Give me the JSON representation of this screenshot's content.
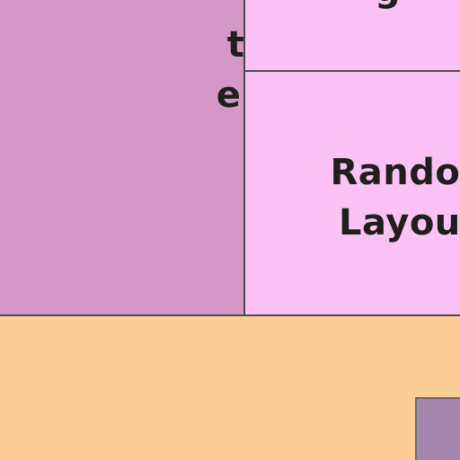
{
  "tiles": {
    "purple": {
      "line1": "ting",
      "line2": "eme)",
      "color": "#d597c6"
    },
    "pink_top": {
      "label": "g",
      "color": "#fbc2f3"
    },
    "pink_mid": {
      "line1": "Rando",
      "line2": "Layou",
      "color": "#fbc2f3"
    },
    "orange": {
      "color": "#fdcd96"
    },
    "mauve": {
      "color": "#a387aa"
    }
  }
}
